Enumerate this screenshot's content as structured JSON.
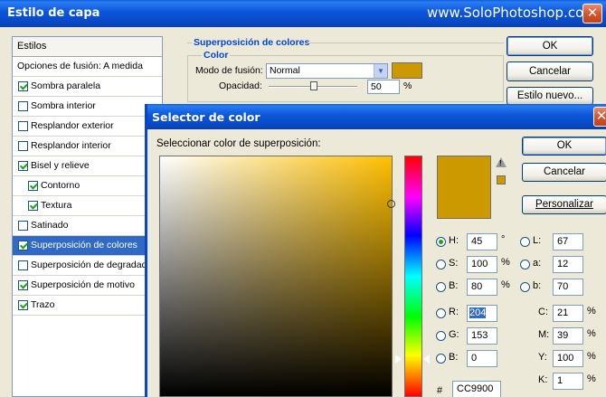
{
  "layer_style": {
    "title": "Estilo de capa",
    "watermark": "www.SoloPhotoshop.com",
    "styles_header": "Estilos",
    "blend_options": "Opciones de fusión: A medida",
    "items": [
      {
        "label": "Sombra paralela",
        "checked": true
      },
      {
        "label": "Sombra interior",
        "checked": false
      },
      {
        "label": "Resplandor exterior",
        "checked": false
      },
      {
        "label": "Resplandor interior",
        "checked": false
      },
      {
        "label": "Bisel y relieve",
        "checked": true
      },
      {
        "label": "Contorno",
        "checked": true
      },
      {
        "label": "Textura",
        "checked": true
      },
      {
        "label": "Satinado",
        "checked": false
      },
      {
        "label": "Superposición de colores",
        "checked": true
      },
      {
        "label": "Superposición de degradado",
        "checked": false
      },
      {
        "label": "Superposición de motivo",
        "checked": true
      },
      {
        "label": "Trazo",
        "checked": true
      }
    ],
    "group_title": "Superposición de colores",
    "color_subtitle": "Color",
    "blend_mode_label": "Modo de fusión:",
    "blend_mode_value": "Normal",
    "opacity_label": "Opacidad:",
    "opacity_value": "50",
    "opacity_unit": "%",
    "ok_label": "OK",
    "cancel_label": "Cancelar",
    "new_style_label": "Estilo nuevo..."
  },
  "color_picker": {
    "title": "Selector de color",
    "prompt": "Seleccionar color de superposición:",
    "ok_label": "OK",
    "cancel_label": "Cancelar",
    "custom_label": "Personalizar",
    "color_hex": "#cc9900",
    "hsb": [
      {
        "label": "H:",
        "value": "45",
        "unit": "°",
        "selected": true
      },
      {
        "label": "S:",
        "value": "100",
        "unit": "%",
        "selected": false
      },
      {
        "label": "B:",
        "value": "80",
        "unit": "%",
        "selected": false
      }
    ],
    "rgb": [
      {
        "label": "R:",
        "value": "204",
        "selected": false
      },
      {
        "label": "G:",
        "value": "153",
        "selected": false
      },
      {
        "label": "B:",
        "value": "0",
        "selected": false
      }
    ],
    "lab": [
      {
        "label": "L:",
        "value": "67"
      },
      {
        "label": "a:",
        "value": "12"
      },
      {
        "label": "b:",
        "value": "70"
      }
    ],
    "cmyk": [
      {
        "label": "C:",
        "value": "21",
        "unit": "%"
      },
      {
        "label": "M:",
        "value": "39",
        "unit": "%"
      },
      {
        "label": "Y:",
        "value": "100",
        "unit": "%"
      },
      {
        "label": "K:",
        "value": "1",
        "unit": "%"
      }
    ],
    "hex_label": "#",
    "hex_value": "CC9900"
  }
}
